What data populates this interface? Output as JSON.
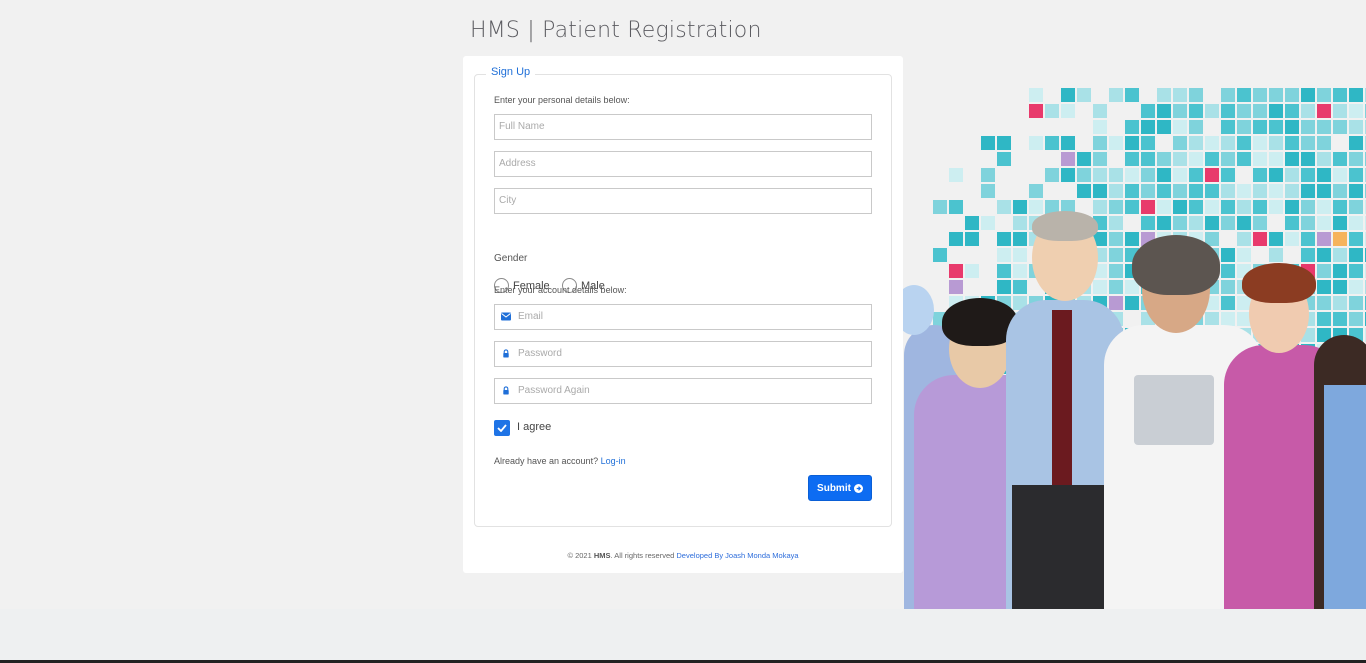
{
  "page": {
    "title": "HMS | Patient Registration"
  },
  "form": {
    "legend": "Sign Up",
    "personal_hint": "Enter your personal details below:",
    "full_name_placeholder": "Full Name",
    "address_placeholder": "Address",
    "city_placeholder": "City",
    "gender_label": "Gender",
    "gender_options": [
      "Female",
      "Male"
    ],
    "account_hint": "Enter your account details below:",
    "email_placeholder": "Email",
    "password_placeholder": "Password",
    "password_again_placeholder": "Password Again",
    "agree_label": "I agree",
    "agree_checked": true,
    "already_text": "Already have an account?",
    "login_link": "Log-in",
    "submit_label": "Submit"
  },
  "footer": {
    "copyright": "© 2021",
    "brand": "HMS",
    "rights": ". All rights reserved",
    "developer": "Developed By Joash Monda Mokaya"
  },
  "colors": {
    "accent": "#0d6cf2",
    "background": "#f1f1f1",
    "mosaic_teal": "#4bc3cf"
  },
  "icons": {
    "email": "envelope-icon",
    "password": "lock-icon",
    "checkbox": "check-icon",
    "submit": "arrow-circle-right-icon"
  }
}
